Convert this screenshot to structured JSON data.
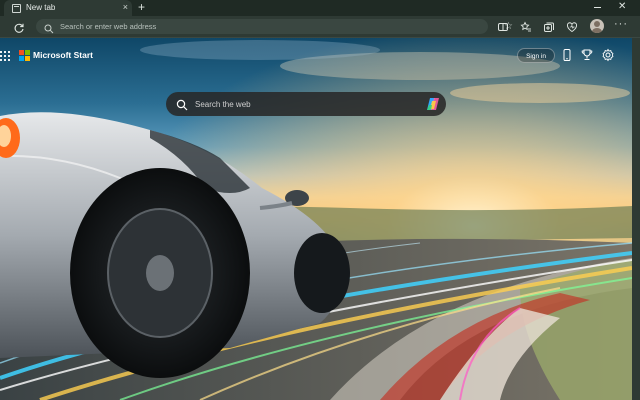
{
  "tab": {
    "title": "New tab",
    "close_glyph": "×",
    "favicon": "page-icon"
  },
  "new_tab_glyph": "+",
  "window": {
    "minimize_icon": "minimize-icon",
    "close_glyph": "✕"
  },
  "toolbar": {
    "address_placeholder": "Search or enter web address",
    "favorite_glyph": "☆",
    "more_glyph": "···",
    "icons": [
      "refresh-icon",
      "search-icon",
      "favorite-star-icon",
      "split-screen-icon",
      "favorites-icon",
      "collections-icon",
      "browser-essentials-icon",
      "profile-avatar",
      "more-icon"
    ]
  },
  "page": {
    "brand": "Microsoft Start",
    "sign_in": "Sign in",
    "search_placeholder": "Search the web",
    "icons": [
      "apps-grid-icon",
      "phone-icon",
      "rewards-trophy-icon",
      "settings-gear-icon",
      "copilot-icon"
    ],
    "logo_colors": [
      "#f25022",
      "#7fba00",
      "#00a4ef",
      "#ffb900"
    ],
    "background": "sports car racing on a track at sunset with light trails"
  },
  "colors": {
    "chrome": "#2e3a34",
    "tabstrip": "#1f2a24",
    "omnibox": "#3a4741"
  }
}
